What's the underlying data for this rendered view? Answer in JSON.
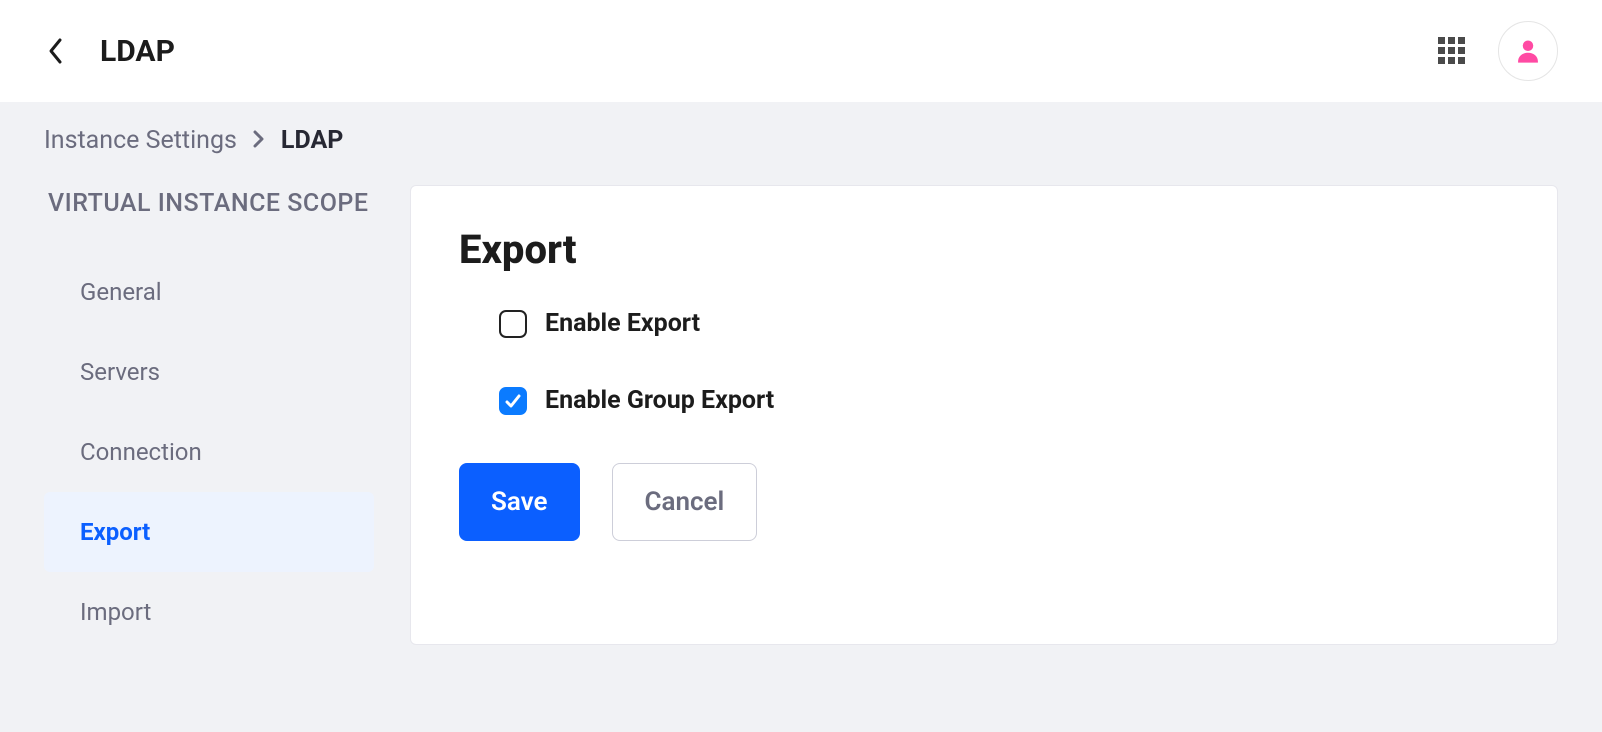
{
  "header": {
    "title": "LDAP"
  },
  "breadcrumb": {
    "parent": "Instance Settings",
    "current": "LDAP"
  },
  "sidebar": {
    "heading": "VIRTUAL INSTANCE SCOPE",
    "items": [
      {
        "label": "General",
        "active": false
      },
      {
        "label": "Servers",
        "active": false
      },
      {
        "label": "Connection",
        "active": false
      },
      {
        "label": "Export",
        "active": true
      },
      {
        "label": "Import",
        "active": false
      }
    ]
  },
  "panel": {
    "heading": "Export",
    "fields": {
      "enable_export": {
        "label": "Enable Export",
        "checked": false
      },
      "enable_group_export": {
        "label": "Enable Group Export",
        "checked": true
      }
    },
    "buttons": {
      "save": "Save",
      "cancel": "Cancel"
    }
  }
}
